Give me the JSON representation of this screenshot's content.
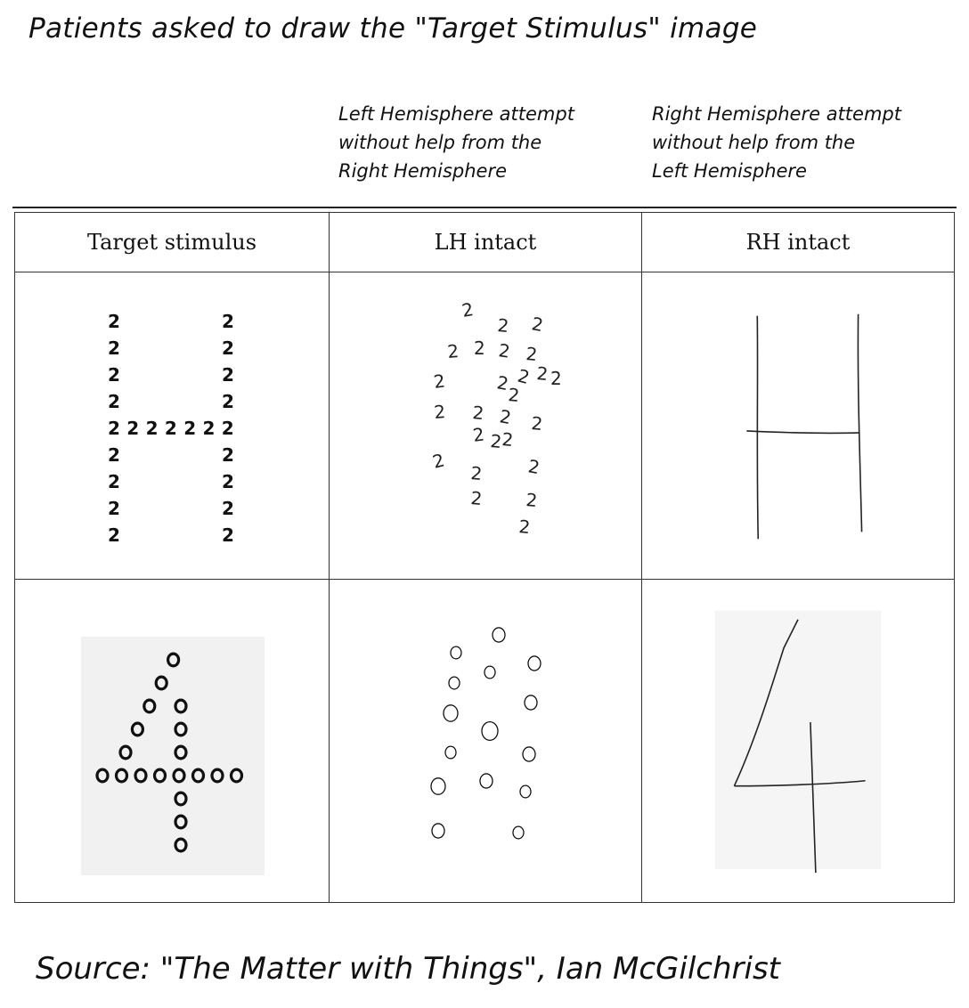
{
  "title": "Patients asked to draw the \"Target Stimulus\" image",
  "notes": {
    "left": "Left Hemisphere attempt\nwithout help from the\nRight Hemisphere",
    "right": "Right Hemisphere attempt\nwithout help from the\nLeft Hemisphere"
  },
  "table": {
    "headers": [
      "Target stimulus",
      "LH intact",
      "RH intact"
    ],
    "rows": [
      {
        "stimulus_glyph": "2",
        "stimulus_shape": "H"
      },
      {
        "stimulus_glyph": "o",
        "stimulus_shape": "4"
      }
    ]
  },
  "source": "Source: \"The Matter with Things\", Ian McGilchrist"
}
